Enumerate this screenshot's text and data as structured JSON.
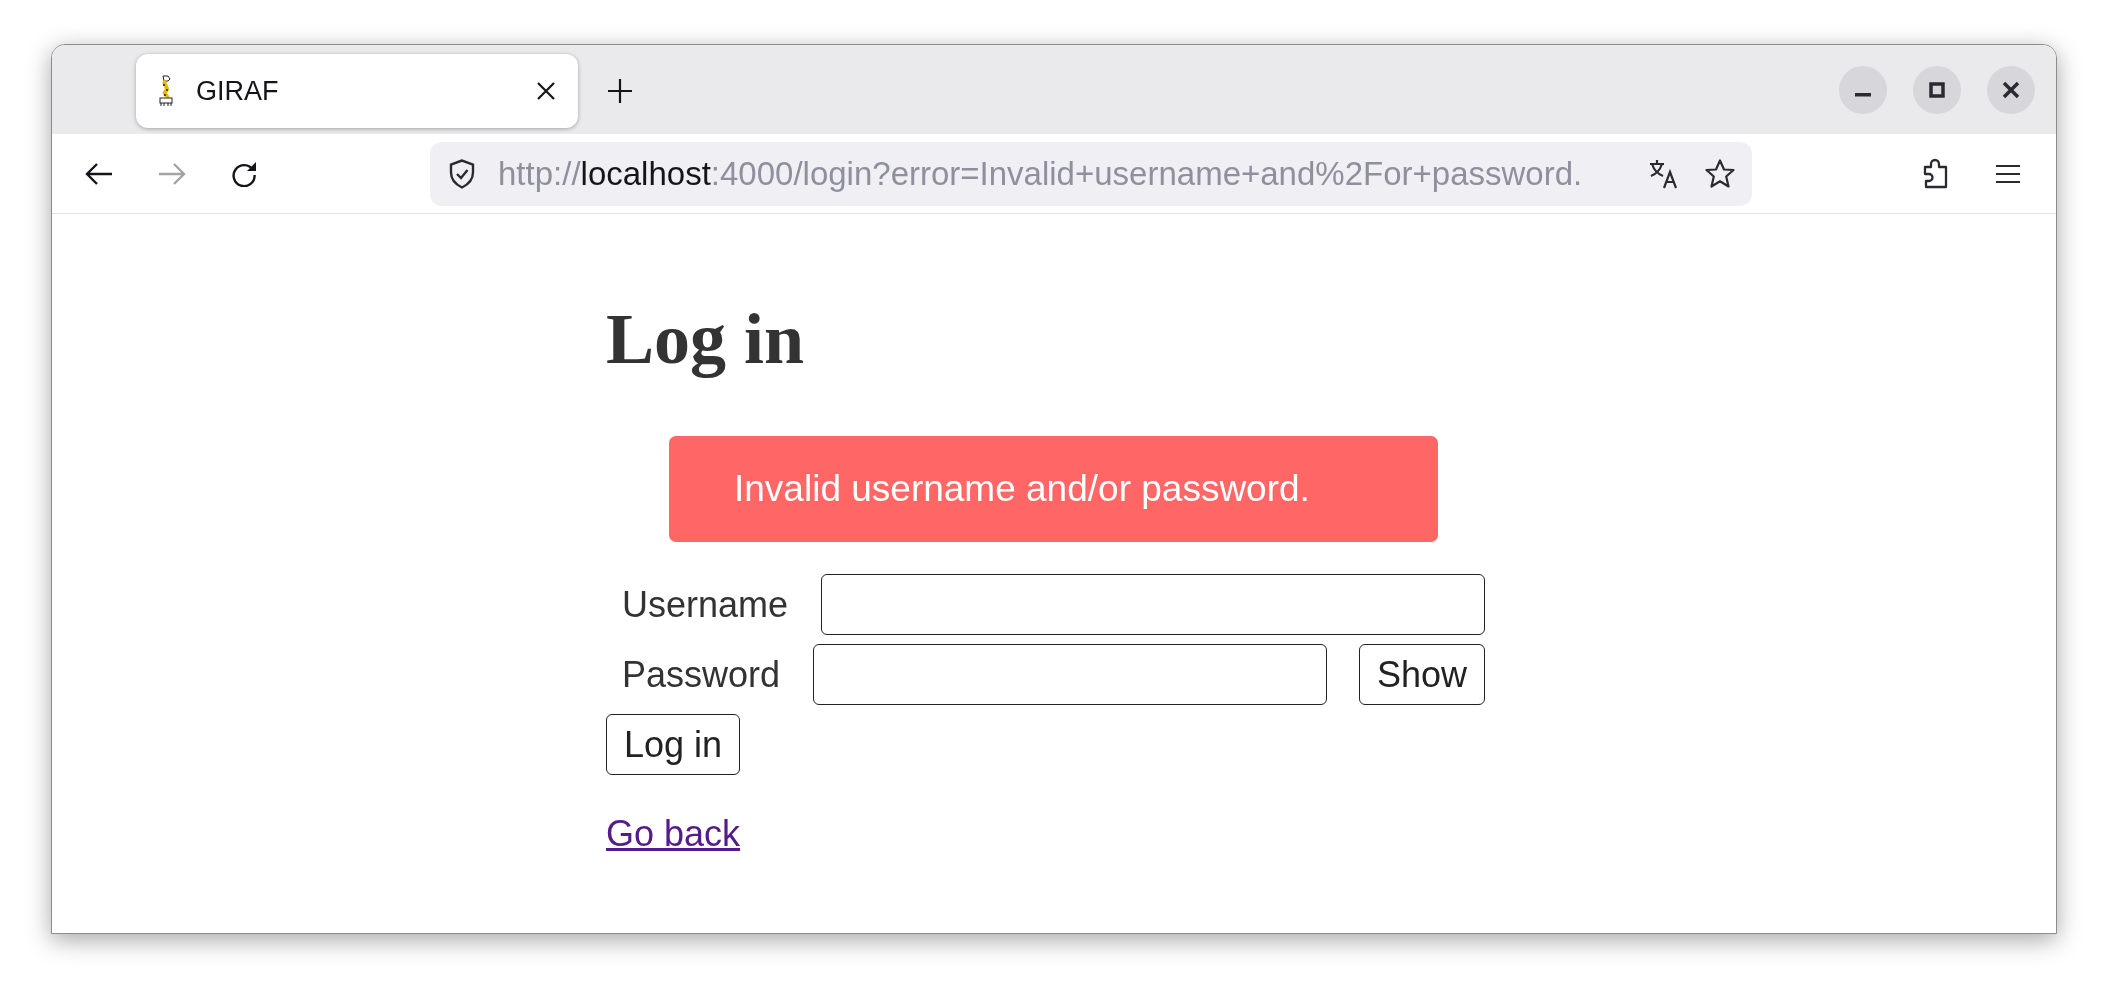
{
  "window": {
    "tabs": [
      {
        "title": "GIRAF",
        "selected": true
      }
    ]
  },
  "toolbar": {
    "nav_buttons": [
      {
        "kind": "back",
        "disabled": false
      },
      {
        "kind": "forward",
        "disabled": true
      },
      {
        "kind": "reload",
        "disabled": false
      }
    ],
    "url": [
      {
        "text": "http://",
        "highlighted": false
      },
      {
        "text": "localhost",
        "highlighted": true
      },
      {
        "text": ":4000/login?error=Invalid+username+and%2For+password.",
        "highlighted": false
      }
    ]
  },
  "page": {
    "heading": "Log in",
    "error": "Invalid username and/or password.",
    "fields": [
      {
        "label": "Username"
      },
      {
        "label": "Password",
        "button": "Show"
      }
    ],
    "submit": "Log in",
    "link": "Go back"
  }
}
